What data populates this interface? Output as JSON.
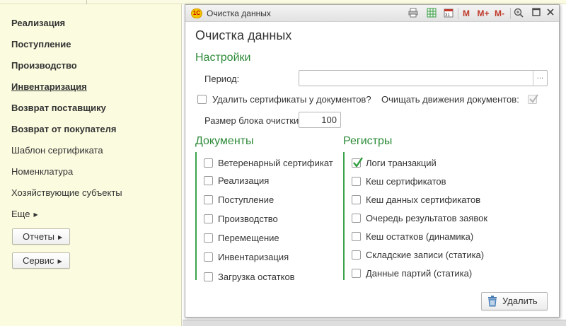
{
  "sidebar": {
    "items": [
      {
        "label": "Реализация"
      },
      {
        "label": "Поступление"
      },
      {
        "label": "Производство"
      },
      {
        "label": "Инвентаризация"
      },
      {
        "label": "Возврат поставщику"
      },
      {
        "label": "Возврат от покупателя"
      },
      {
        "label": "Шаблон сертификата"
      },
      {
        "label": "Номенклатура"
      },
      {
        "label": "Хозяйствующие субъекты"
      },
      {
        "label": "Еще"
      }
    ],
    "buttons": [
      {
        "label": "Отчеты"
      },
      {
        "label": "Сервис"
      }
    ]
  },
  "window": {
    "title": "Очистка данных",
    "logo_text": "1С",
    "toolbar": {
      "m": "M",
      "m_plus": "M+",
      "m_minus": "M-",
      "calendar_day": "31"
    }
  },
  "form": {
    "title": "Очистка данных",
    "settings_heading": "Настройки",
    "period_label": "Период:",
    "period_value": "",
    "period_button": "...",
    "delete_certs_label": "Удалить сертификаты у документов?",
    "delete_certs_checked": false,
    "clear_movements_label": "Очищать движения документов:",
    "clear_movements_checked": true,
    "block_size_label": "Размер блока очистки:",
    "block_size_value": "100",
    "documents_heading": "Документы",
    "documents": [
      {
        "label": "Ветеренарный сертификат",
        "checked": false
      },
      {
        "label": "Реализация",
        "checked": false
      },
      {
        "label": "Поступление",
        "checked": false
      },
      {
        "label": "Производство",
        "checked": false
      },
      {
        "label": "Перемещение",
        "checked": false
      },
      {
        "label": "Инвентаризация",
        "checked": false
      },
      {
        "label": "Загрузка остатков",
        "checked": false
      }
    ],
    "registers_heading": "Регистры",
    "registers": [
      {
        "label": "Логи транзакций",
        "checked": true
      },
      {
        "label": "Кеш сертификатов",
        "checked": false
      },
      {
        "label": "Кеш данных сертификатов",
        "checked": false
      },
      {
        "label": "Очередь результатов заявок",
        "checked": false
      },
      {
        "label": "Кеш остатков (динамика)",
        "checked": false
      },
      {
        "label": "Складские записи (статика)",
        "checked": false
      },
      {
        "label": "Данные партий (статика)",
        "checked": false
      }
    ],
    "delete_button": "Удалить"
  },
  "colors": {
    "sidebar_bg": "#fbfbe0",
    "section_heading": "#2e8b3a",
    "check_green": "#2e9e3e",
    "window_border": "#a9a9a9"
  },
  "icons": {
    "print": "print-icon",
    "spreadsheet": "spreadsheet-icon",
    "calendar": "calendar-icon",
    "zoom": "zoom-icon",
    "maximize": "maximize-icon",
    "close": "close-icon",
    "trash": "trash-icon"
  }
}
